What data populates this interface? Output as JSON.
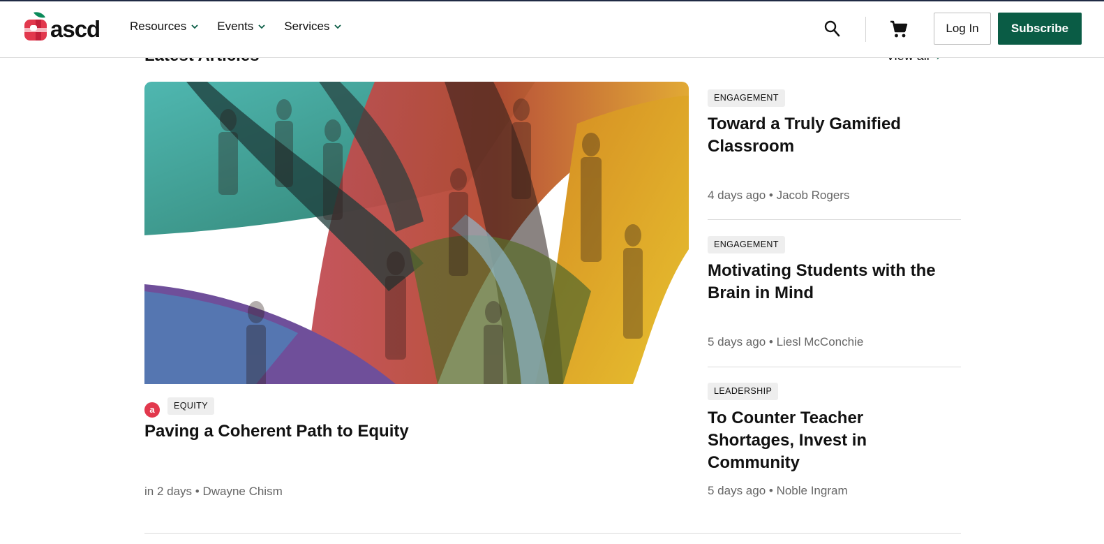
{
  "header": {
    "logo_text": "ascd",
    "nav": [
      {
        "label": "Resources"
      },
      {
        "label": "Events"
      },
      {
        "label": "Services"
      }
    ],
    "login_label": "Log In",
    "subscribe_label": "Subscribe"
  },
  "section": {
    "title": "Latest Articles",
    "view_all": "View all",
    "view_all_arrow": "›"
  },
  "feature": {
    "avatar_letter": "a",
    "category": "EQUITY",
    "title": "Paving a Coherent Path to Equity",
    "meta": "in 2 days • Dwayne Chism"
  },
  "articles": [
    {
      "category": "ENGAGEMENT",
      "title": "Toward a Truly Gamified Classroom",
      "meta": "4 days ago • Jacob Rogers"
    },
    {
      "category": "ENGAGEMENT",
      "title": "Motivating Students with the Brain in Mind",
      "meta": "5 days ago • Liesl McConchie"
    },
    {
      "category": "LEADERSHIP",
      "title": "To Counter Teacher Shortages, Invest in Community",
      "meta": "5 days ago • Noble Ingram"
    }
  ],
  "colors": {
    "brand_green": "#0a5c45",
    "brand_red": "#e2384d",
    "header_line": "#1f2a44"
  },
  "icons": [
    "search-icon",
    "cart-icon",
    "chevron-down-icon",
    "ascd-logo-mark"
  ]
}
